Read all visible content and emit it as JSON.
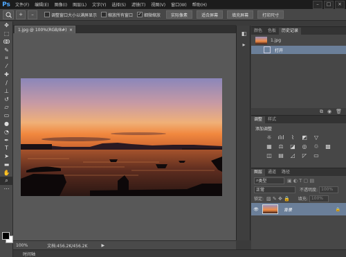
{
  "app": {
    "logo": "Ps"
  },
  "menu": [
    "文件(F)",
    "编辑(E)",
    "图像(I)",
    "图层(L)",
    "文字(Y)",
    "选择(S)",
    "滤镜(T)",
    "视图(V)",
    "窗口(W)",
    "帮助(H)"
  ],
  "window_controls": {
    "minimize": "–",
    "restore": "□",
    "close": "×"
  },
  "options": {
    "zoom_in": "+",
    "zoom_out": "–",
    "check_resize_window": "调整窗口大小以满屏显示",
    "check_zoom_all": "缩放所有窗口",
    "check_scrubby_zoom": "细微缩放",
    "btn_actual_pixels": "实际像素",
    "btn_fit_screen": "适合屏幕",
    "btn_fill_screen": "填充屏幕",
    "btn_print_size": "打印尺寸"
  },
  "document": {
    "tab_title": "1.jpg @ 100%(RGB/8#)",
    "close_glyph": "×"
  },
  "status": {
    "zoom": "100%",
    "doc_info": "文档:456.2K/456.2K",
    "arrow": "▶"
  },
  "timeline": {
    "label": "时间轴"
  },
  "history_panel": {
    "tabs": [
      "颜色",
      "色板",
      "历史记录"
    ],
    "snapshot_name": "1.jpg",
    "step": "打开"
  },
  "adjust_panel": {
    "tabs": [
      "调整",
      "样式"
    ],
    "title": "添加调整"
  },
  "layers_panel": {
    "tabs": [
      "图层",
      "通道",
      "路径"
    ],
    "filter_kind": "类型",
    "blend_mode": "正常",
    "opacity_label": "不透明度:",
    "opacity_value": "100%",
    "lock_label": "锁定:",
    "fill_label": "填充:",
    "fill_value": "100%",
    "layer_name": "背景"
  },
  "colors": {
    "accent": "#4fa8ff",
    "selected_row": "#6b7f99",
    "sky_top": "#8a86b8",
    "sky_horizon": "#f28e4c",
    "water": "#3a1e1a"
  }
}
